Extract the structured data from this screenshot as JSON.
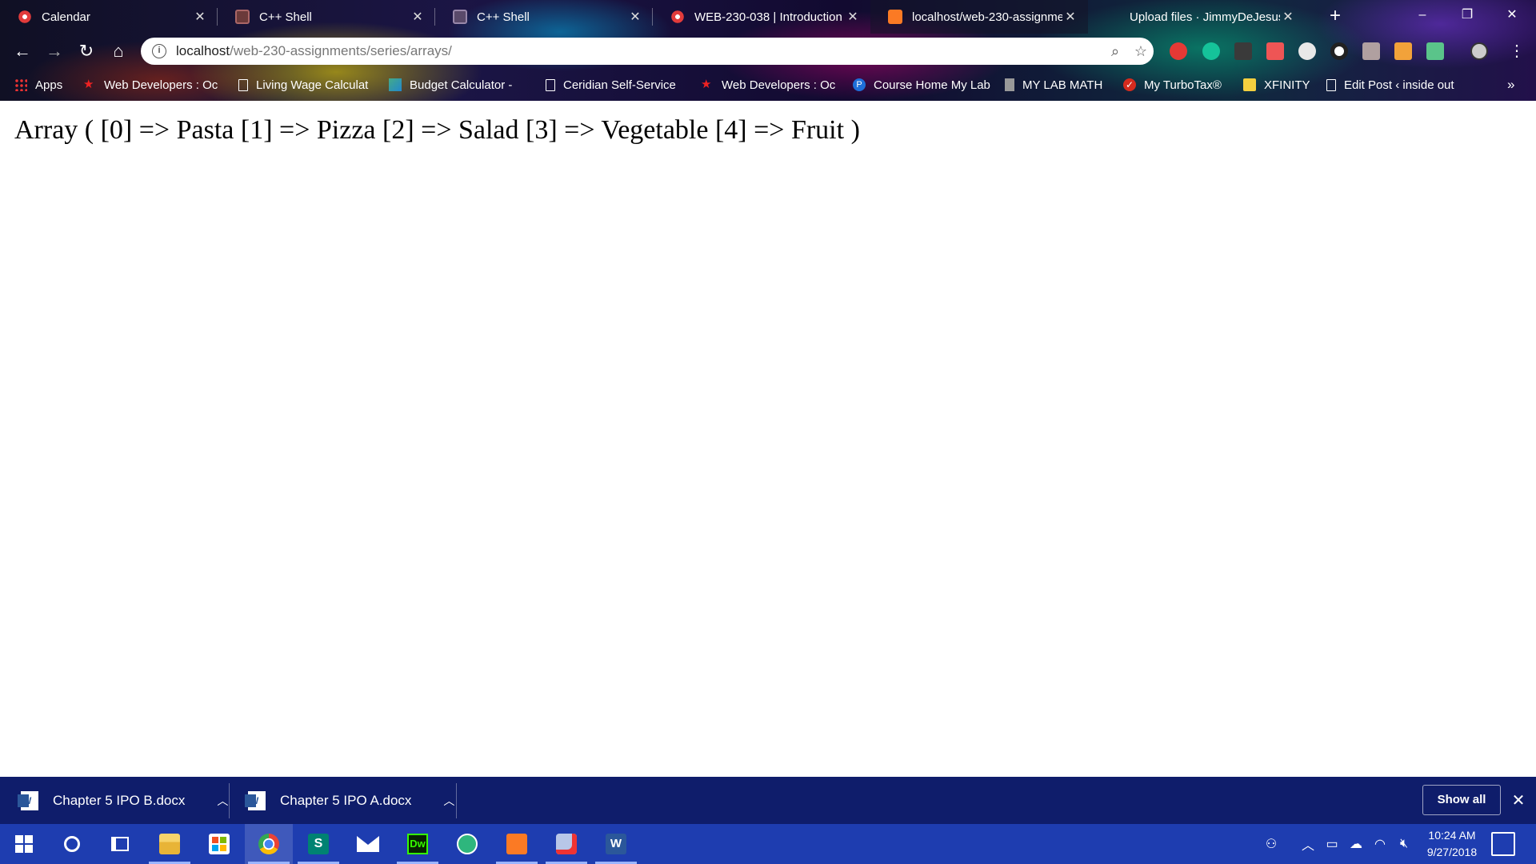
{
  "tabs": [
    {
      "title": "Calendar",
      "active": false
    },
    {
      "title": "C++ Shell",
      "active": false
    },
    {
      "title": "C++ Shell",
      "active": false
    },
    {
      "title": "WEB-230-038 | Introduction",
      "active": false
    },
    {
      "title": "localhost/web-230-assignme",
      "active": true
    },
    {
      "title": "Upload files · JimmyDeJesus/",
      "active": false
    }
  ],
  "new_tab_label": "+",
  "window_controls": {
    "minimize": "–",
    "restore": "❐",
    "close": "✕"
  },
  "address_bar": {
    "host": "localhost",
    "path": "/web-230-assignments/series/arrays/"
  },
  "bookmarks": [
    "Apps",
    "Web Developers : Oc",
    "Living Wage Calculat",
    "Budget Calculator -",
    "Ceridian Self-Service",
    "Web Developers : Oc",
    "Course Home My Lab",
    "MY LAB MATH",
    "My TurboTax®",
    "XFINITY",
    "Edit Post ‹ inside out"
  ],
  "bookmarks_overflow": "»",
  "page": {
    "output": "Array ( [0] => Pasta [1] => Pizza [2] => Salad [3] => Vegetable [4] => Fruit )"
  },
  "downloads": [
    {
      "name": "Chapter 5 IPO B.docx"
    },
    {
      "name": "Chapter 5 IPO A.docx"
    }
  ],
  "download_bar": {
    "show_all": "Show all",
    "close": "✕"
  },
  "taskbar": {
    "apps": [
      "start",
      "cortana",
      "task-view",
      "file-explorer",
      "store",
      "chrome",
      "sway",
      "mail",
      "dreamweaver",
      "sourcetree",
      "xampp",
      "snip",
      "word"
    ],
    "active_app": "chrome",
    "clock_time": "10:24 AM",
    "clock_date": "9/27/2018"
  },
  "colors": {
    "download_bar": "#0f1d6b",
    "taskbar": "#1e3db0",
    "page_bg": "#ffffff"
  }
}
